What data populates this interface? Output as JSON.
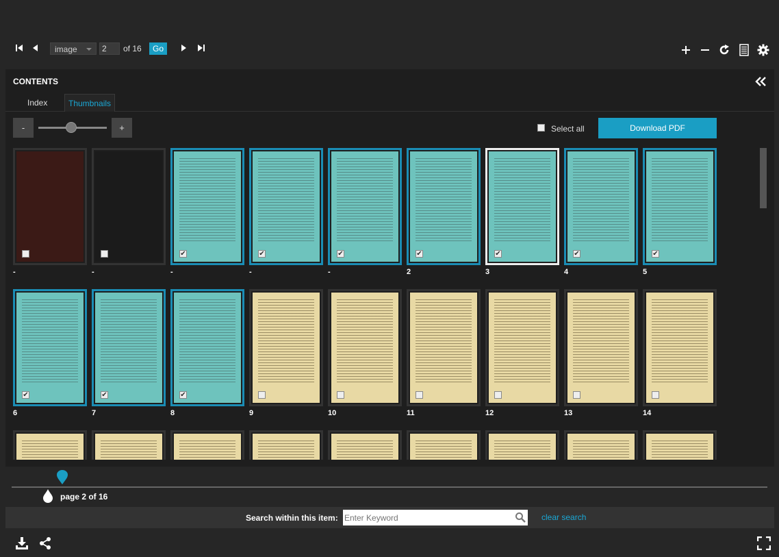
{
  "toolbar": {
    "view_mode": "image",
    "page_value": "2",
    "of_total": "of 16",
    "go_label": "Go",
    "icons": [
      "first-page-icon",
      "prev-page-icon",
      "next-page-icon",
      "last-page-icon",
      "zoom-in-icon",
      "zoom-out-icon",
      "rotate-icon",
      "text-view-icon",
      "settings-icon"
    ]
  },
  "contents": {
    "title": "CONTENTS",
    "tabs": [
      {
        "label": "Index",
        "active": false
      },
      {
        "label": "Thumbnails",
        "active": true
      }
    ],
    "zoom_minus": "-",
    "zoom_plus": "+",
    "zoom_level": 0.5,
    "select_all_label": "Select all",
    "select_all_checked": false,
    "download_pdf_label": "Download PDF",
    "thumbnails": [
      {
        "label": "-",
        "kind": "cover1",
        "selected": false,
        "current": false
      },
      {
        "label": "-",
        "kind": "cover2",
        "selected": false,
        "current": false
      },
      {
        "label": "-",
        "kind": "teal",
        "selected": true,
        "current": false
      },
      {
        "label": "-",
        "kind": "teal",
        "selected": true,
        "current": false
      },
      {
        "label": "-",
        "kind": "teal",
        "selected": true,
        "current": false
      },
      {
        "label": "2",
        "kind": "teal",
        "selected": true,
        "current": false
      },
      {
        "label": "3",
        "kind": "teal",
        "selected": true,
        "current": true
      },
      {
        "label": "4",
        "kind": "teal",
        "selected": true,
        "current": false
      },
      {
        "label": "5",
        "kind": "teal",
        "selected": true,
        "current": false
      },
      {
        "label": "6",
        "kind": "teal",
        "selected": true,
        "current": false
      },
      {
        "label": "7",
        "kind": "teal",
        "selected": true,
        "current": false
      },
      {
        "label": "8",
        "kind": "teal",
        "selected": true,
        "current": false
      },
      {
        "label": "9",
        "kind": "paper",
        "selected": false,
        "current": false
      },
      {
        "label": "10",
        "kind": "paper",
        "selected": false,
        "current": false
      },
      {
        "label": "11",
        "kind": "paper",
        "selected": false,
        "current": false
      },
      {
        "label": "12",
        "kind": "paper",
        "selected": false,
        "current": false
      },
      {
        "label": "13",
        "kind": "paper",
        "selected": false,
        "current": false
      },
      {
        "label": "14",
        "kind": "paper",
        "selected": false,
        "current": false
      },
      {
        "label": "",
        "kind": "paper",
        "selected": false,
        "current": false
      },
      {
        "label": "",
        "kind": "paper",
        "selected": false,
        "current": false
      },
      {
        "label": "",
        "kind": "paper",
        "selected": false,
        "current": false
      },
      {
        "label": "",
        "kind": "paper",
        "selected": false,
        "current": false
      },
      {
        "label": "",
        "kind": "paper",
        "selected": false,
        "current": false
      },
      {
        "label": "",
        "kind": "paper",
        "selected": false,
        "current": false
      },
      {
        "label": "",
        "kind": "paper",
        "selected": false,
        "current": false
      },
      {
        "label": "",
        "kind": "paper",
        "selected": false,
        "current": false
      },
      {
        "label": "",
        "kind": "paper",
        "selected": false,
        "current": false
      }
    ]
  },
  "page_slider": {
    "status": "page 2 of 16",
    "position_fraction": 0.0667
  },
  "search": {
    "label": "Search within this item:",
    "placeholder": "Enter Keyword",
    "clear_label": "clear search"
  },
  "footer": {
    "icons": [
      "download-icon",
      "share-icon",
      "fullscreen-icon"
    ]
  },
  "colors": {
    "accent": "#1a9ec4",
    "selected_border": "#1a8db5",
    "background": "#262626"
  }
}
